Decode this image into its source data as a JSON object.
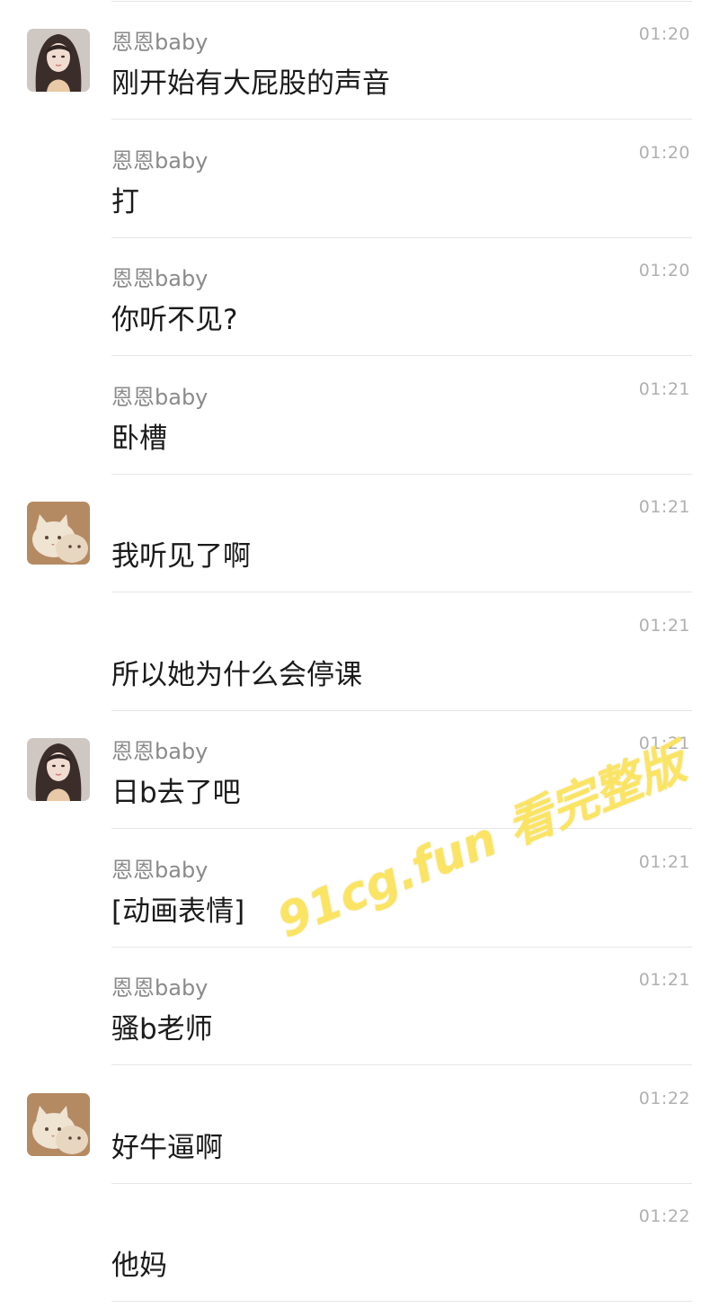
{
  "chat": {
    "messages": [
      {
        "sender": "恩恩baby",
        "time": "01:20",
        "text": "刚开始有大屁股的声音",
        "avatar": "girl"
      },
      {
        "sender": "恩恩baby",
        "time": "01:20",
        "text": "打",
        "avatar": ""
      },
      {
        "sender": "恩恩baby",
        "time": "01:20",
        "text": "你听不见?",
        "avatar": ""
      },
      {
        "sender": "恩恩baby",
        "time": "01:21",
        "text": "卧槽",
        "avatar": ""
      },
      {
        "sender": "",
        "time": "01:21",
        "text": "我听见了啊",
        "avatar": "cat"
      },
      {
        "sender": "",
        "time": "01:21",
        "text": "所以她为什么会停课",
        "avatar": ""
      },
      {
        "sender": "恩恩baby",
        "time": "01:21",
        "text": "日b去了吧",
        "avatar": "girl"
      },
      {
        "sender": "恩恩baby",
        "time": "01:21",
        "text": "[动画表情]",
        "avatar": ""
      },
      {
        "sender": "恩恩baby",
        "time": "01:21",
        "text": "骚b老师",
        "avatar": ""
      },
      {
        "sender": "",
        "time": "01:22",
        "text": "好牛逼啊",
        "avatar": "cat"
      },
      {
        "sender": "",
        "time": "01:22",
        "text": "他妈",
        "avatar": ""
      }
    ]
  },
  "watermark": {
    "text": "91cg.fun 看完整版",
    "color": "#fbe35b"
  },
  "icons": {
    "girl_avatar": "girl-avatar-icon",
    "cat_avatar": "cat-avatar-icon"
  }
}
